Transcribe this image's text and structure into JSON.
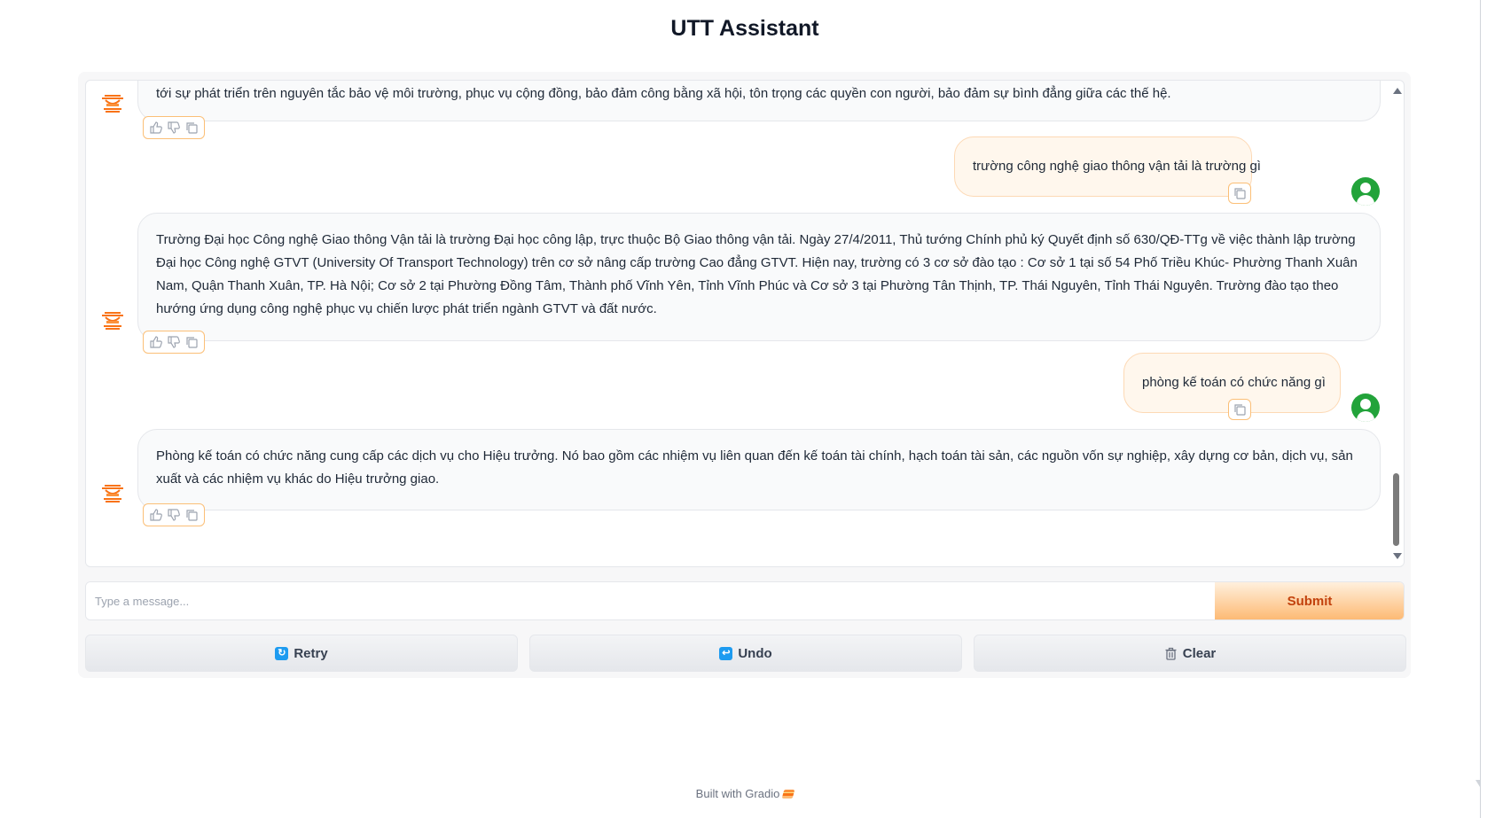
{
  "app": {
    "title": "UTT Assistant"
  },
  "chat": {
    "messages": [
      {
        "role": "bot",
        "text": "tới sự phát triển trên nguyên tắc bảo vệ môi trường, phục vụ cộng đồng, bảo đảm công bằng xã hội, tôn trọng các quyền con người, bảo đảm sự bình đẳng giữa các thế hệ."
      },
      {
        "role": "user",
        "text": "trường công nghệ giao thông vận tải là trường gì"
      },
      {
        "role": "bot",
        "text": "Trường Đại học Công nghệ Giao thông Vận tải là trường Đại học công lập, trực thuộc Bộ Giao thông vận tải. Ngày 27/4/2011, Thủ tướng Chính phủ ký Quyết định số 630/QĐ-TTg về việc thành lập trường Đại học Công nghệ GTVT (University Of Transport Technology) trên cơ sở nâng cấp trường Cao đẳng GTVT. Hiện nay, trường có 3 cơ sở đào tạo : Cơ sở 1 tại số 54 Phố Triều Khúc- Phường Thanh Xuân Nam, Quận Thanh Xuân, TP. Hà Nội; Cơ sở 2 tại Phường Đồng Tâm, Thành phố Vĩnh Yên, Tỉnh Vĩnh Phúc và Cơ sở 3 tại Phường Tân Thịnh, TP. Thái Nguyên, Tỉnh Thái Nguyên. Trường đào tạo theo hướng ứng dụng công nghệ phục vụ chiến lược phát triển ngành GTVT và đất nước."
      },
      {
        "role": "user",
        "text": "phòng kế toán có chức năng gì"
      },
      {
        "role": "bot",
        "text": "Phòng kế toán có chức năng cung cấp các dịch vụ cho Hiệu trưởng. Nó bao gồm các nhiệm vụ liên quan đến kế toán tài chính, hạch toán tài sản, các nguồn vốn sự nghiệp, xây dựng cơ bản, dịch vụ, sản xuất và các nhiệm vụ khác do Hiệu trưởng giao."
      }
    ]
  },
  "input": {
    "placeholder": "Type a message...",
    "value": ""
  },
  "buttons": {
    "submit": "Submit",
    "retry": "Retry",
    "undo": "Undo",
    "clear": "Clear"
  },
  "footer": {
    "text": "Built with Gradio"
  },
  "colors": {
    "accent": "#f97316",
    "user_avatar": "#22a33a",
    "submit_text": "#c2410c"
  }
}
